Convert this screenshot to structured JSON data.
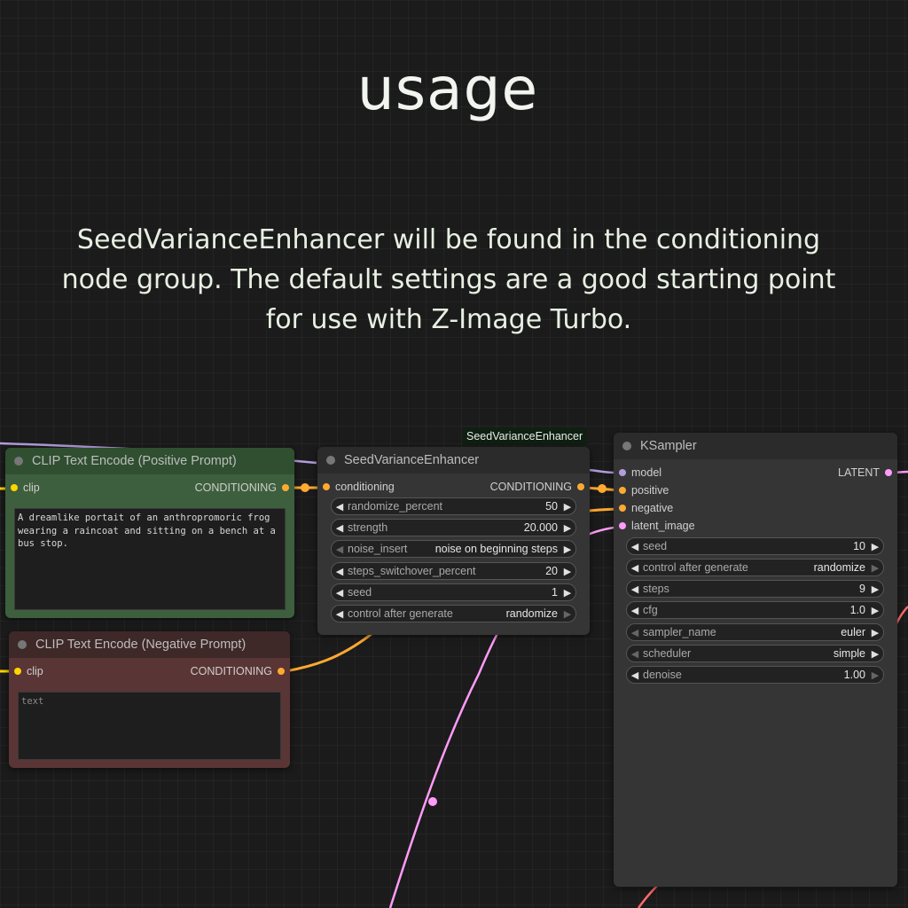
{
  "headline": "usage",
  "description": "SeedVarianceEnhancer will be found in the conditioning node group. The default settings are a good starting point for use with Z-Image Turbo.",
  "group_tag": "SeedVarianceEnhancer",
  "positive_node": {
    "title": "CLIP Text Encode (Positive Prompt)",
    "input_label": "clip",
    "output_label": "CONDITIONING",
    "text_value": "A dreamlike portait of an anthropromoric frog wearing a raincoat and sitting on a bench at a bus stop.",
    "header_color": "#2f4f30",
    "body_color": "#3d5f3d"
  },
  "negative_node": {
    "title": "CLIP Text Encode (Negative Prompt)",
    "input_label": "clip",
    "output_label": "CONDITIONING",
    "text_placeholder": "text",
    "header_color": "#3f2828",
    "body_color": "#5a3535"
  },
  "sve_node": {
    "title": "SeedVarianceEnhancer",
    "input_label": "conditioning",
    "output_label": "CONDITIONING",
    "widgets": [
      {
        "name": "randomize_percent",
        "value": "50"
      },
      {
        "name": "strength",
        "value": "20.000"
      },
      {
        "name": "noise_insert",
        "value": "noise on beginning steps"
      },
      {
        "name": "steps_switchover_percent",
        "value": "20"
      },
      {
        "name": "seed",
        "value": "1"
      },
      {
        "name": "control after generate",
        "value": "randomize"
      }
    ]
  },
  "ksampler_node": {
    "title": "KSampler",
    "inputs": [
      "model",
      "positive",
      "negative",
      "latent_image"
    ],
    "output_label": "LATENT",
    "widgets": [
      {
        "name": "seed",
        "value": "10"
      },
      {
        "name": "control after generate",
        "value": "randomize"
      },
      {
        "name": "steps",
        "value": "9"
      },
      {
        "name": "cfg",
        "value": "1.0"
      },
      {
        "name": "sampler_name",
        "value": "euler"
      },
      {
        "name": "scheduler",
        "value": "simple"
      },
      {
        "name": "denoise",
        "value": "1.00"
      }
    ]
  },
  "icons": {
    "left_arrow": "◀",
    "right_arrow": "▶"
  },
  "colors": {
    "clip_slot": "#ffd500",
    "conditioning_slot": "#ffa931",
    "model_slot": "#b39ddb",
    "latent_slot": "#ff9cf9",
    "latent_wire": "#ff9cf9",
    "conditioning_wire": "#ffa931",
    "model_wire": "#b39ddb"
  }
}
